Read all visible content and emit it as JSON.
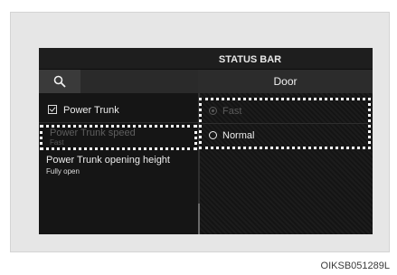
{
  "status_bar": {
    "title": "STATUS BAR"
  },
  "header": {
    "panel_title": "Door"
  },
  "left_menu": {
    "power_trunk": {
      "label": "Power Trunk",
      "checked": true
    },
    "power_trunk_speed": {
      "label": "Power Trunk speed",
      "value": "Fast",
      "disabled": true
    },
    "opening_height": {
      "label": "Power Trunk opening height",
      "value": "Fully open"
    }
  },
  "options": [
    {
      "label": "Fast",
      "selected": true,
      "disabled": true
    },
    {
      "label": "Normal",
      "selected": false,
      "disabled": false
    }
  ],
  "figure_code": "OIKSB051289L",
  "icons": {
    "search": "search-icon",
    "checkbox": "checkbox-icon",
    "radio": "radio-icon"
  }
}
